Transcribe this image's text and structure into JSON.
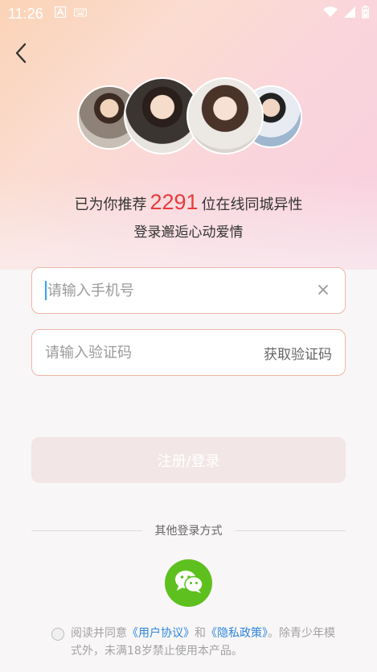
{
  "status_bar": {
    "time": "11:26",
    "icons": [
      "font-icon",
      "keyboard-icon",
      "wifi-icon",
      "signal-icon",
      "battery-icon"
    ]
  },
  "header": {
    "back_icon": "chevron-left-icon"
  },
  "recommend": {
    "prefix": "已为你推荐",
    "count": "2291",
    "suffix": "位在线同城异性",
    "subline": "登录邂逅心动爱情"
  },
  "form": {
    "phone_placeholder": "请输入手机号",
    "phone_value": "",
    "code_placeholder": "请输入验证码",
    "code_value": "",
    "get_code_label": "获取验证码",
    "submit_label": "注册/登录"
  },
  "other_login": {
    "label": "其他登录方式",
    "wechat_icon": "wechat-icon"
  },
  "agreement": {
    "t1": "阅读并同意",
    "link1": "《用户协议》",
    "t2": "和",
    "link2": "《隐私政策》",
    "t3": "。除青少年模式外，未满18岁禁止使用本产品。"
  },
  "colors": {
    "accent_red": "#e73b3b",
    "field_border": "#f1b5a7",
    "link": "#2e86de",
    "wechat_green": "#5ec01e"
  }
}
